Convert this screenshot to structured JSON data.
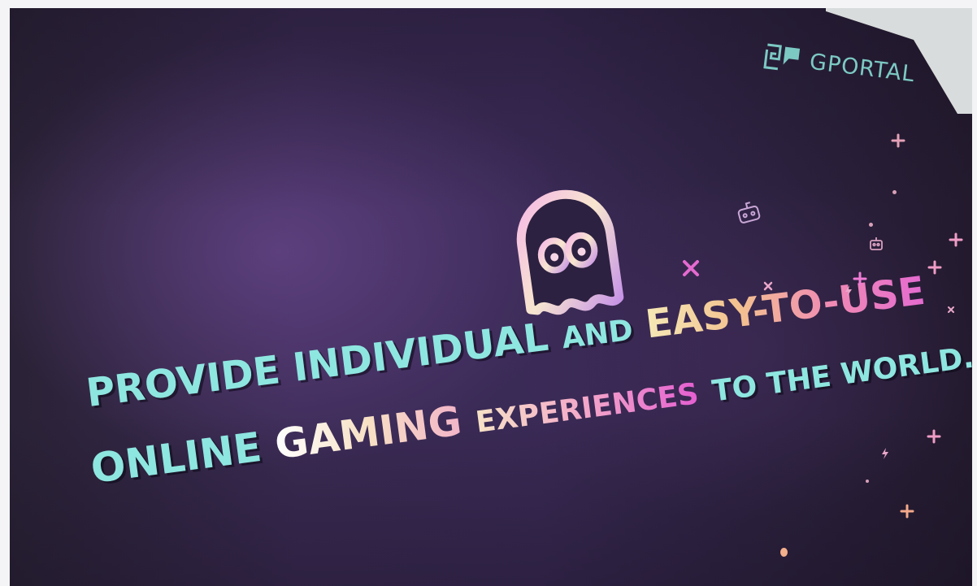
{
  "scene": "wall-mural",
  "brand": {
    "logo_icon": "gportal-logo-icon",
    "name": "GPORTAL",
    "color": "#7cc9c3"
  },
  "mascot": {
    "icon": "ghost-icon"
  },
  "headline": {
    "line1": {
      "part1": "PROVIDE INDIVIDUAL",
      "part2": "AND",
      "part3": "EASY-TO-USE"
    },
    "line2": {
      "part1": "ONLINE",
      "part2": "GAMING",
      "part3": "EXPERIENCES",
      "part4": "TO THE WORLD."
    }
  },
  "colors": {
    "wall": "#3a2a56",
    "teal": "#8ee6e0",
    "pink": "#e46ad0",
    "cream": "#f5e8b6"
  },
  "decorations": [
    "plus-icon",
    "x-icon",
    "gamepad-icon",
    "robot-icon",
    "lightning-icon",
    "dot-icon"
  ]
}
